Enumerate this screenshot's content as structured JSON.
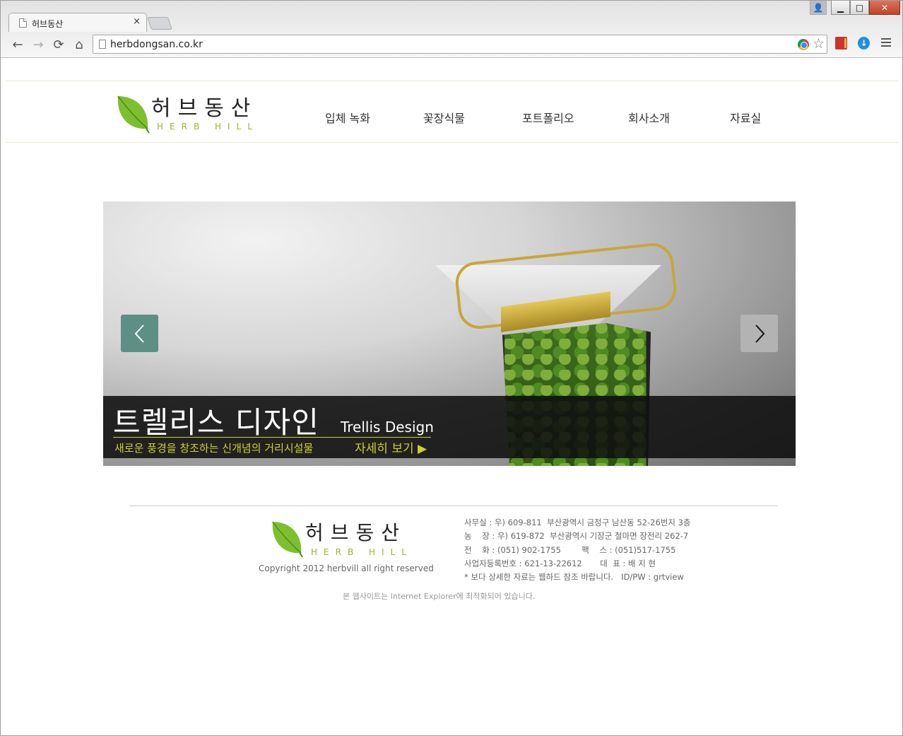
{
  "browser": {
    "tab_title": "허브동산",
    "tab_close": "×",
    "url": "herbdongsan.co.kr",
    "window_buttons": {
      "user": "👤",
      "minimize": "▁",
      "maximize": "□",
      "close": "✕"
    },
    "nav_icons": {
      "back": "←",
      "forward": "→",
      "reload": "⟳",
      "home": "⌂",
      "star": "☆",
      "download": "↓"
    }
  },
  "site": {
    "logo": {
      "name": "허브동산",
      "sub": "HERB HILL"
    },
    "nav": [
      "입체 녹화",
      "꽃장식물",
      "포트폴리오",
      "회사소개",
      "자료실"
    ],
    "slider": {
      "title_ko": "트렐리스 디자인",
      "title_en": "Trellis Design",
      "subtitle": "새로운 풍경을 창조하는 신개념의 거리시설물",
      "more": "자세히 보기 ▶"
    },
    "footer": {
      "logo_name": "허브동산",
      "logo_sub": "HERB HILL",
      "copyright": "Copyright 2012 herbvill  all right reserved",
      "info": [
        "사무실 : 우) 609-811  부산광역시 금정구 남산동 52-26번지 3층",
        "농    장 : 우) 619-872  부산광역시 기장군 철마면 장전리 262-7",
        "전    화 : (051) 902-1755        팩    스 : (051)517-1755",
        "사업자등록번호 : 621-13-22612       대  표 : 배 지 현",
        "* 보다 상세한 자료는 웹하드 참조 바랍니다.   ID/PW : grtview"
      ],
      "optimized": "본 웹사이트는 Internet Explorer에 최적화되어 있습니다."
    },
    "colors": {
      "accent_green": "#9ab52a",
      "caption_yellow": "#cdd22a",
      "prev_button": "#5d8f85"
    }
  }
}
